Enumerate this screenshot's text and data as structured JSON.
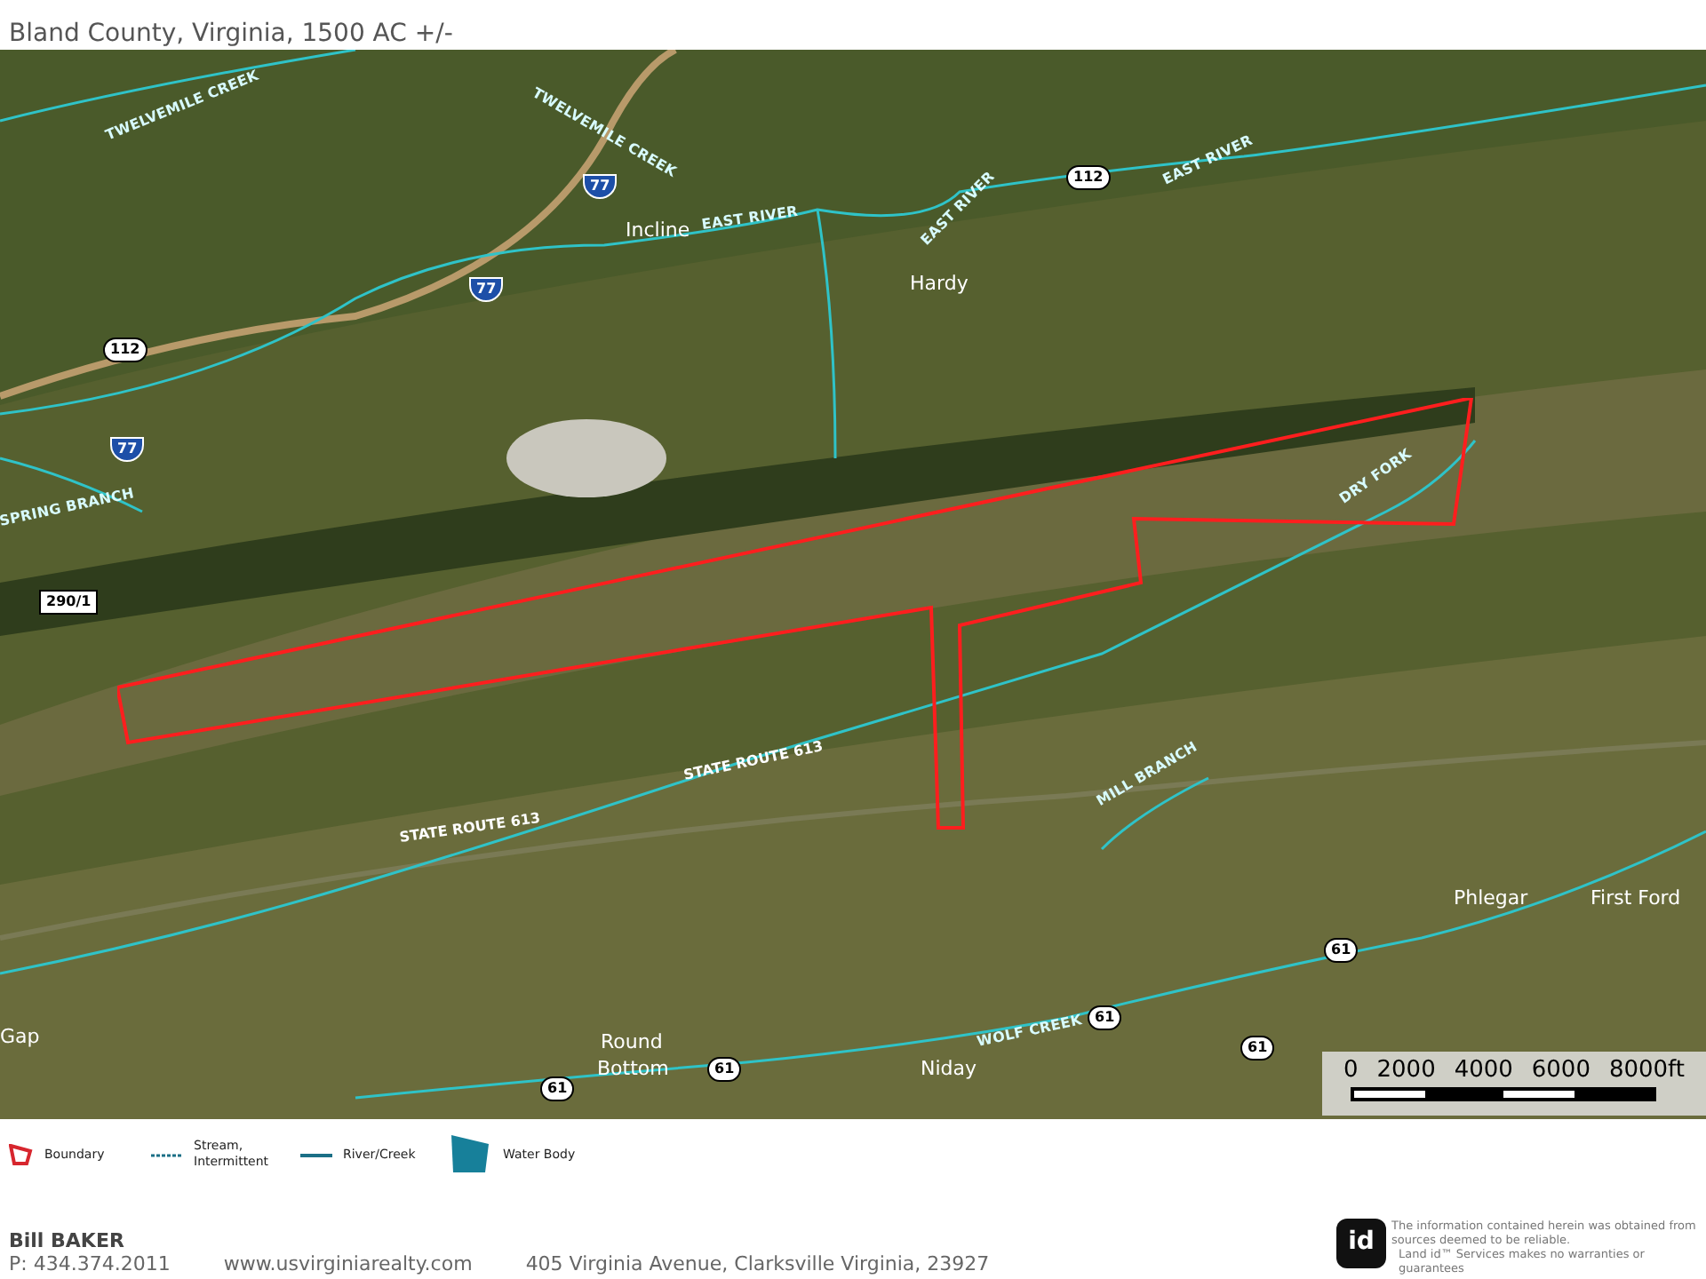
{
  "header": {
    "subtitle": "Bland County, Virginia, 1500 AC +/-"
  },
  "map": {
    "labels": [
      {
        "text": "TWELVEMILE CREEK",
        "kind": "water"
      },
      {
        "text": "TWELVEMILE CREEK",
        "kind": "water"
      },
      {
        "text": "Incline",
        "kind": "place"
      },
      {
        "text": "EAST RIVER",
        "kind": "water"
      },
      {
        "text": "EAST RIVER",
        "kind": "water"
      },
      {
        "text": "EAST RIVER",
        "kind": "water"
      },
      {
        "text": "Hardy",
        "kind": "place"
      },
      {
        "text": "SPRING BRANCH",
        "kind": "water"
      },
      {
        "text": "DRY FORK",
        "kind": "water"
      },
      {
        "text": "STATE ROUTE 613",
        "kind": "road"
      },
      {
        "text": "STATE ROUTE 613",
        "kind": "road"
      },
      {
        "text": "MILL BRANCH",
        "kind": "water"
      },
      {
        "text": "Phlegar",
        "kind": "place"
      },
      {
        "text": "First Ford",
        "kind": "place"
      },
      {
        "text": "Round",
        "kind": "place"
      },
      {
        "text": "Bottom",
        "kind": "place"
      },
      {
        "text": "Niday",
        "kind": "place"
      },
      {
        "text": "WOLF CREEK",
        "kind": "water"
      },
      {
        "text": "Gap",
        "kind": "place"
      }
    ],
    "shields": [
      {
        "text": "77",
        "kind": "interstate"
      },
      {
        "text": "77",
        "kind": "interstate"
      },
      {
        "text": "77",
        "kind": "interstate"
      },
      {
        "text": "112",
        "kind": "state"
      },
      {
        "text": "112",
        "kind": "state"
      },
      {
        "text": "290/1",
        "kind": "county"
      },
      {
        "text": "61",
        "kind": "state"
      },
      {
        "text": "61",
        "kind": "state"
      },
      {
        "text": "61",
        "kind": "state"
      },
      {
        "text": "61",
        "kind": "state"
      },
      {
        "text": "61",
        "kind": "state"
      }
    ],
    "scale_bar": {
      "ticks": [
        "0",
        "2000",
        "4000",
        "6000",
        "8000ft"
      ]
    }
  },
  "legend": [
    {
      "kind": "boundary",
      "label": "Boundary"
    },
    {
      "kind": "stream",
      "label": "Stream, Intermittent"
    },
    {
      "kind": "river",
      "label": "River/Creek"
    },
    {
      "kind": "water_body",
      "label": "Water Body"
    }
  ],
  "footer": {
    "agent": "Bill BAKER",
    "phone": "P: 434.374.2011",
    "website": "www.usvirginiarealty.com",
    "address": "405 Virginia Avenue, Clarksville Virginia, 23927",
    "logo": "id",
    "disclaimer": "The information contained herein was obtained from sources deemed to be reliable.",
    "disclaimer_2": "Land id™ Services makes no warranties or guarantees"
  }
}
